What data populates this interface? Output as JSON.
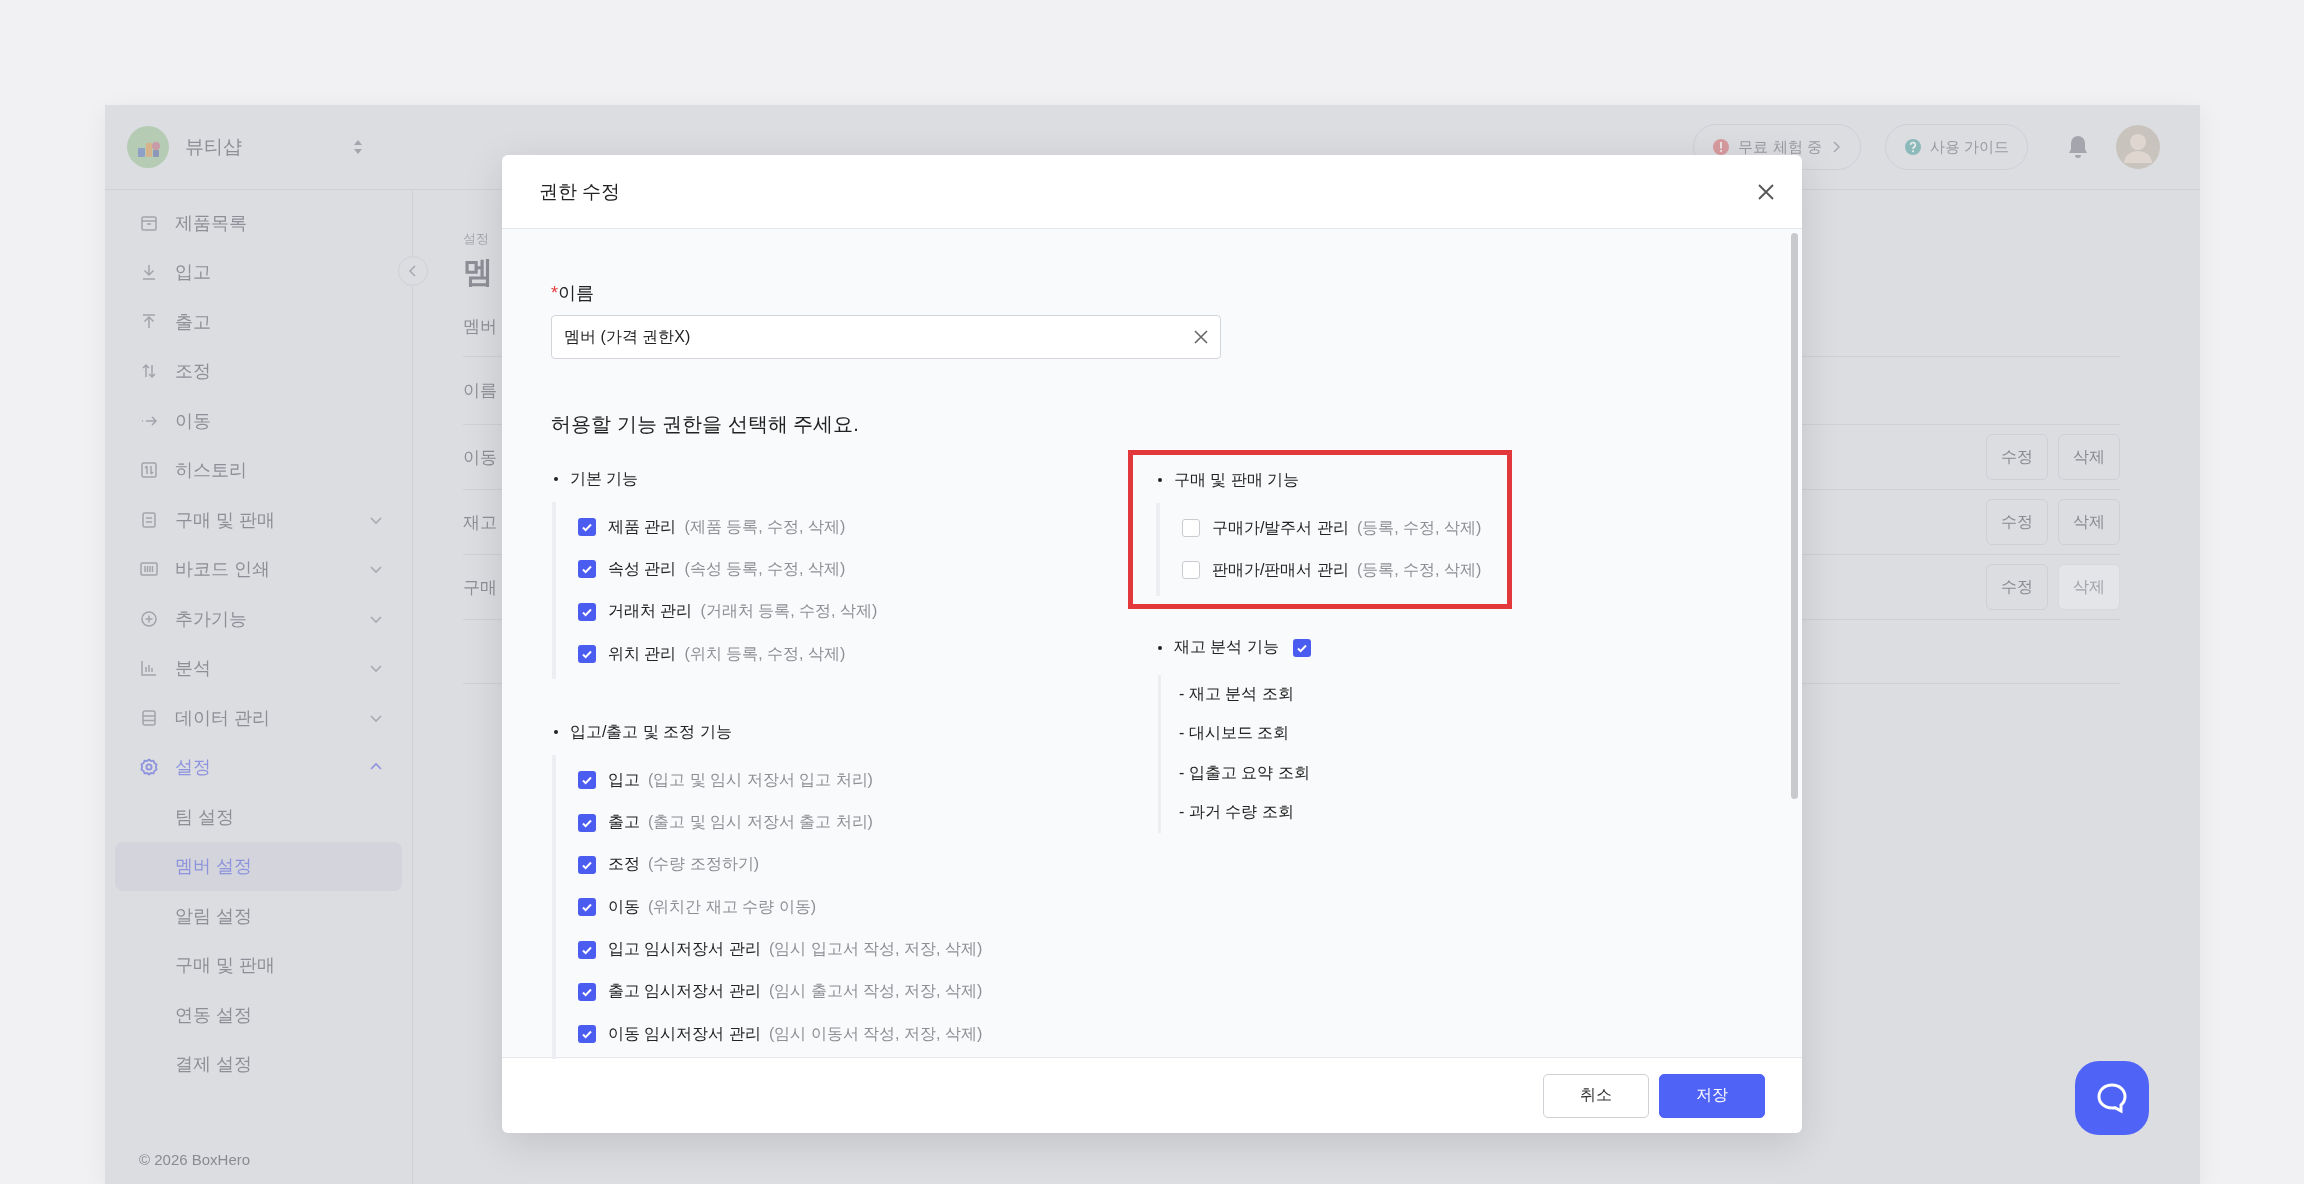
{
  "header": {
    "team_name": "뷰티샵",
    "trial_badge": "무료 체험 중",
    "guide_button": "사용 가이드"
  },
  "sidebar": {
    "items": [
      {
        "label": "제품목록",
        "selected": false
      },
      {
        "label": "입고",
        "selected": false
      },
      {
        "label": "출고",
        "selected": false
      },
      {
        "label": "조정",
        "selected": false
      },
      {
        "label": "이동",
        "selected": false
      },
      {
        "label": "히스토리",
        "selected": false
      },
      {
        "label": "구매 및 판매",
        "selected": false,
        "expanded": false
      },
      {
        "label": "바코드 인쇄",
        "selected": false,
        "expanded": false
      },
      {
        "label": "추가기능",
        "selected": false,
        "expanded": false
      },
      {
        "label": "분석",
        "selected": false,
        "expanded": false
      },
      {
        "label": "데이터 관리",
        "selected": false,
        "expanded": false
      },
      {
        "label": "설정",
        "selected": true,
        "expanded": true,
        "children": [
          {
            "label": "팀 설정",
            "selected": false
          },
          {
            "label": "멤버 설정",
            "selected": true
          },
          {
            "label": "알림 설정",
            "selected": false
          },
          {
            "label": "구매 및 판매",
            "selected": false
          },
          {
            "label": "연동 설정",
            "selected": false
          },
          {
            "label": "결제 설정",
            "selected": false
          }
        ]
      }
    ],
    "footer": "© 2026 BoxHero"
  },
  "page": {
    "breadcrumb": "설정",
    "title": "멤",
    "tab": "멤버",
    "column_1": "이름",
    "rows": [
      {
        "name": "이동",
        "buttons": [
          {
            "label": "수정",
            "disabled": false
          },
          {
            "label": "삭제",
            "disabled": false
          }
        ]
      },
      {
        "name": "재고",
        "buttons": [
          {
            "label": "수정",
            "disabled": false
          },
          {
            "label": "삭제",
            "disabled": false
          }
        ]
      },
      {
        "name": "구매",
        "buttons": [
          {
            "label": "수정",
            "disabled": false
          },
          {
            "label": "삭제",
            "disabled": true
          }
        ]
      }
    ]
  },
  "dialog": {
    "title": "권한 수정",
    "name_field": {
      "required_mark": "*",
      "label": "이름",
      "value": "멤버 (가격 권한X)"
    },
    "prompt": "허용할 기능 권한을 선택해 주세요.",
    "left_sections": [
      {
        "title": "기본 기능",
        "items": [
          {
            "label": "제품 관리",
            "hint": "(제품 등록, 수정, 삭제)",
            "checked": true
          },
          {
            "label": "속성 관리",
            "hint": "(속성 등록, 수정, 삭제)",
            "checked": true
          },
          {
            "label": "거래처 관리",
            "hint": "(거래처 등록, 수정, 삭제)",
            "checked": true
          },
          {
            "label": "위치 관리",
            "hint": "(위치 등록, 수정, 삭제)",
            "checked": true
          }
        ]
      },
      {
        "title": "입고/출고 및 조정 기능",
        "items": [
          {
            "label": "입고",
            "hint": "(입고 및 임시 저장서 입고 처리)",
            "checked": true
          },
          {
            "label": "출고",
            "hint": "(출고 및 임시 저장서 출고 처리)",
            "checked": true
          },
          {
            "label": "조정",
            "hint": "(수량 조정하기)",
            "checked": true
          },
          {
            "label": "이동",
            "hint": "(위치간 재고 수량 이동)",
            "checked": true
          },
          {
            "label": "입고 임시저장서 관리",
            "hint": "(임시 입고서 작성, 저장, 삭제)",
            "checked": true
          },
          {
            "label": "출고 임시저장서 관리",
            "hint": "(임시 출고서 작성, 저장, 삭제)",
            "checked": true
          },
          {
            "label": "이동 임시저장서 관리",
            "hint": "(임시 이동서 작성, 저장, 삭제)",
            "checked": true
          }
        ]
      }
    ],
    "right_sections": [
      {
        "title": "구매 및 판매 기능",
        "highlighted": true,
        "items": [
          {
            "label": "구매가/발주서 관리",
            "hint": "(등록, 수정, 삭제)",
            "checked": false
          },
          {
            "label": "판매가/판매서 관리",
            "hint": "(등록, 수정, 삭제)",
            "checked": false
          }
        ]
      },
      {
        "title": "재고 분석 기능",
        "checked": true,
        "details": [
          "- 재고 분석 조회",
          "- 대시보드 조회",
          "- 입출고 요약 조회",
          "- 과거 수량 조회"
        ]
      }
    ],
    "buttons": [
      {
        "label": "취소",
        "kind": "secondary"
      },
      {
        "label": "저장",
        "kind": "primary"
      }
    ]
  }
}
